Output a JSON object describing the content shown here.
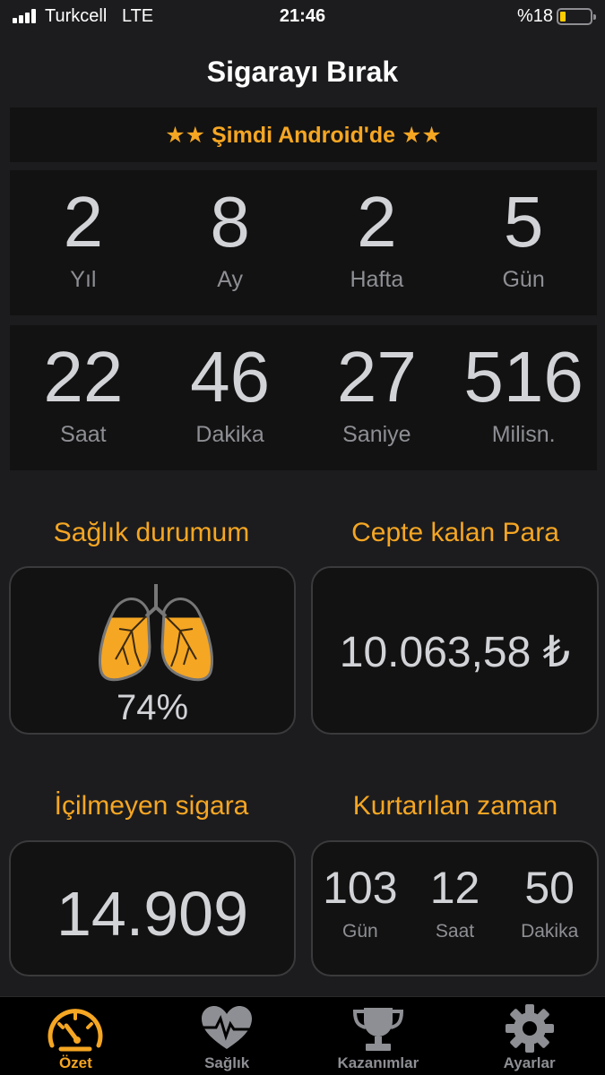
{
  "status_bar": {
    "carrier": "Turkcell",
    "network": "LTE",
    "time": "21:46",
    "battery_text": "%18",
    "battery_level": 0.18
  },
  "title": "Sigarayı Bırak",
  "promo": "★★ Şimdi Android'de ★★",
  "duration_top": [
    {
      "value": "2",
      "label": "Yıl"
    },
    {
      "value": "8",
      "label": "Ay"
    },
    {
      "value": "2",
      "label": "Hafta"
    },
    {
      "value": "5",
      "label": "Gün"
    }
  ],
  "duration_bottom": [
    {
      "value": "22",
      "label": "Saat"
    },
    {
      "value": "46",
      "label": "Dakika"
    },
    {
      "value": "27",
      "label": "Saniye"
    },
    {
      "value": "516",
      "label": "Milisn."
    }
  ],
  "health": {
    "title": "Sağlık durumum",
    "percent_text": "74%",
    "percent": 0.74
  },
  "money": {
    "title": "Cepte kalan Para",
    "value": "10.063,58 ₺"
  },
  "cigarettes": {
    "title": "İçilmeyen sigara",
    "value": "14.909"
  },
  "saved_time": {
    "title": "Kurtarılan zaman",
    "items": [
      {
        "value": "103",
        "label": "Gün"
      },
      {
        "value": "12",
        "label": "Saat"
      },
      {
        "value": "50",
        "label": "Dakika"
      }
    ]
  },
  "tabs": [
    {
      "label": "Özet",
      "icon": "speedometer-icon",
      "active": true
    },
    {
      "label": "Sağlık",
      "icon": "heart-pulse-icon",
      "active": false
    },
    {
      "label": "Kazanımlar",
      "icon": "trophy-icon",
      "active": false
    },
    {
      "label": "Ayarlar",
      "icon": "gear-icon",
      "active": false
    }
  ],
  "colors": {
    "accent": "#f5a623",
    "background": "#1c1c1e",
    "panel": "#121212",
    "text": "#d2d3d7",
    "muted": "#8e8f94"
  }
}
